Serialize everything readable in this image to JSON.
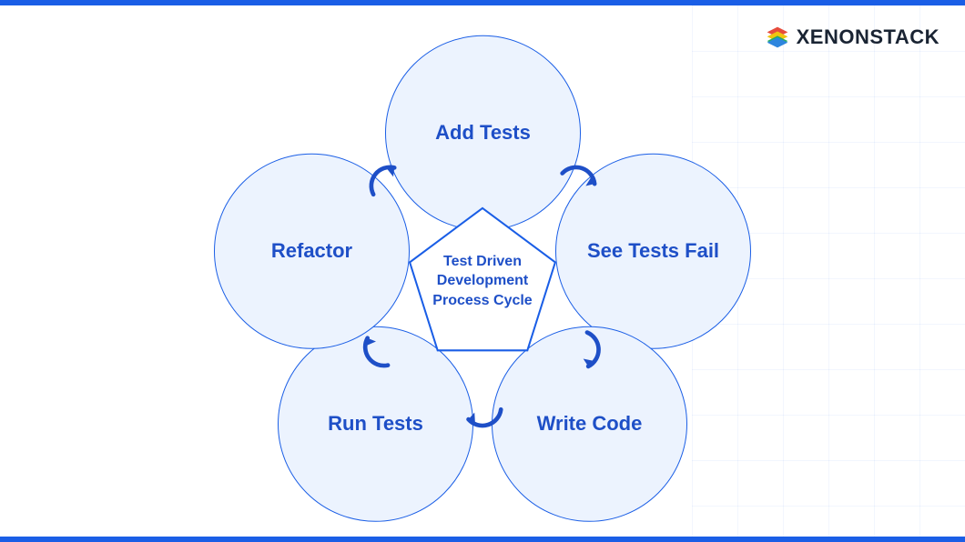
{
  "brand": {
    "name": "XENONSTACK"
  },
  "diagram": {
    "center_label": "Test Driven Development Process Cycle",
    "steps": [
      {
        "id": "add-tests",
        "label": "Add Tests"
      },
      {
        "id": "see-fail",
        "label": "See Tests Fail"
      },
      {
        "id": "write-code",
        "label": "Write Code"
      },
      {
        "id": "run-tests",
        "label": "Run Tests"
      },
      {
        "id": "refactor",
        "label": "Refactor"
      }
    ]
  },
  "colors": {
    "accent": "#1a5ee6",
    "text": "#1e4fc7",
    "fill": "#ecf3fe"
  }
}
